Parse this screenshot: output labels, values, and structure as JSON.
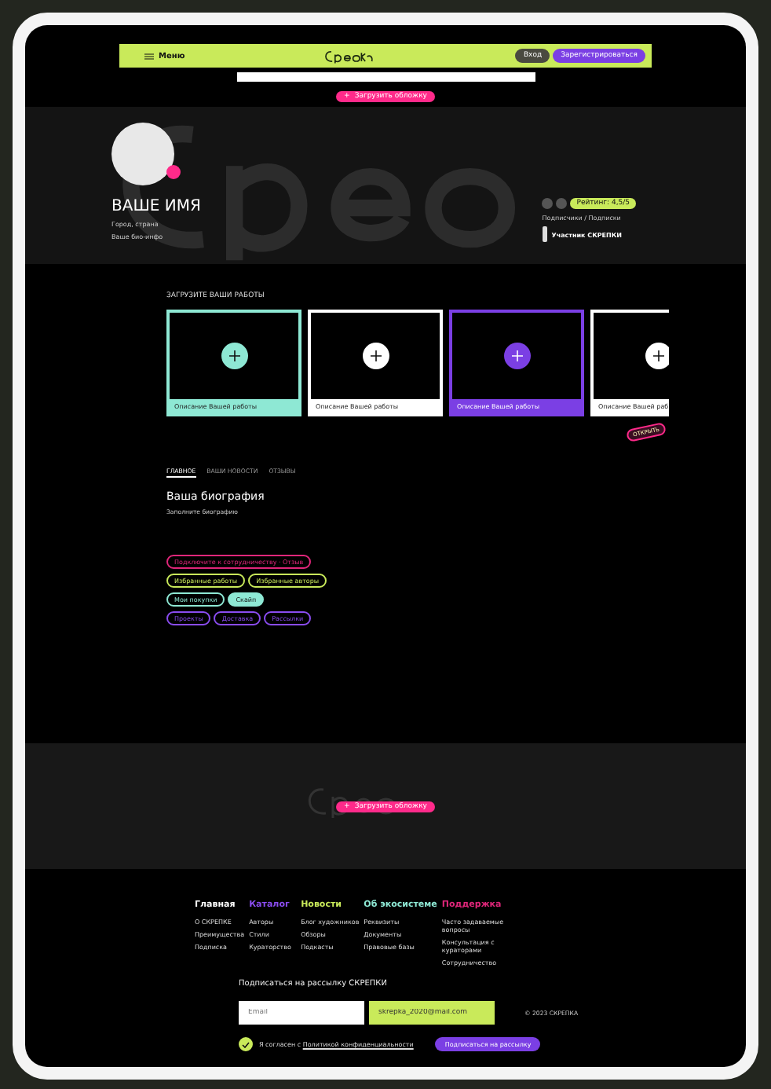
{
  "header": {
    "menu": "Меню",
    "login": "Вход",
    "register": "Зарегистрироваться"
  },
  "cover": {
    "upload": "Загрузить обложку",
    "upload_icon": "+"
  },
  "profile": {
    "name": "ВАШЕ ИМЯ",
    "location": "Город, страна",
    "bio_short": "Ваше био-инфо",
    "rating": "Рейтинг: 4,5/5",
    "follows": "Подписчики / Подписки",
    "member": "Участник СКРЕПКИ"
  },
  "works": {
    "title": "ЗАГРУЗИТЕ ВАШИ РАБОТЫ",
    "sticker": "ОТКРЫТЬ",
    "items": [
      {
        "caption": "Описание Вашей работы",
        "color": "#8ee8d4"
      },
      {
        "caption": "Описание Вашей работы",
        "color": "#ffffff"
      },
      {
        "caption": "Описание Вашей работы",
        "color": "#7b3fe4"
      },
      {
        "caption": "Описание Вашей раб",
        "color": "#ffffff"
      }
    ]
  },
  "tabs": [
    {
      "label": "ГЛАВНОЕ",
      "selected": true
    },
    {
      "label": "ВАШИ НОВОСТИ",
      "selected": false
    },
    {
      "label": "ОТЗЫВЫ",
      "selected": false
    }
  ],
  "bio": {
    "title": "Ваша биография",
    "text": "Заполните биографию"
  },
  "tags": [
    [
      {
        "label": "Подключите к сотрудничеству · Отзыв",
        "color": "#e0267a",
        "filled": false
      }
    ],
    [
      {
        "label": "Избранные работы",
        "color": "#c9ea5a",
        "filled": false
      },
      {
        "label": "Избранные авторы",
        "color": "#c9ea5a",
        "filled": false
      }
    ],
    [
      {
        "label": "Мои покупки",
        "color": "#8ee8d4",
        "filled": false
      },
      {
        "label": "Скайп",
        "color": "#8ee8d4",
        "filled": true
      }
    ],
    [
      {
        "label": "Проекты",
        "color": "#8a4cf0",
        "filled": false
      },
      {
        "label": "Доставка",
        "color": "#8a4cf0",
        "filled": false
      },
      {
        "label": "Рассылки",
        "color": "#8a4cf0",
        "filled": false
      }
    ]
  ],
  "banner": {
    "upload": "Загрузить обложку",
    "upload_icon": "+"
  },
  "footer": {
    "columns": [
      {
        "title": "Главная",
        "color": "#ffffff",
        "links": [
          "О СКРЕПКЕ",
          "Преимущества",
          "Подписка"
        ]
      },
      {
        "title": "Каталог",
        "color": "#8a4cf0",
        "links": [
          "Авторы",
          "Стили",
          "Кураторство"
        ]
      },
      {
        "title": "Новости",
        "color": "#c9ea5a",
        "links": [
          "Блог художников",
          "Обзоры",
          "Подкасты"
        ]
      },
      {
        "title": "Об экосистеме",
        "color": "#8ee8d4",
        "links": [
          "Реквизиты",
          "Документы",
          "Правовые базы"
        ]
      },
      {
        "title": "Поддержка",
        "color": "#e0267a",
        "links": [
          "Часто задаваемые вопросы",
          "Консультация с кураторами",
          "Сотрудничество"
        ]
      }
    ],
    "subscribe_title": "Подписаться на рассылку СКРЕПКИ",
    "name_placeholder": "Email",
    "email": "skrepka_2020@mail.com",
    "copyright": "© 2023 СКРЕПКА",
    "consent": {
      "checked": true,
      "text": "Я согласен с",
      "link": "Политикой конфиденциальности"
    },
    "subscribe_button": "Подписаться на рассылку"
  }
}
